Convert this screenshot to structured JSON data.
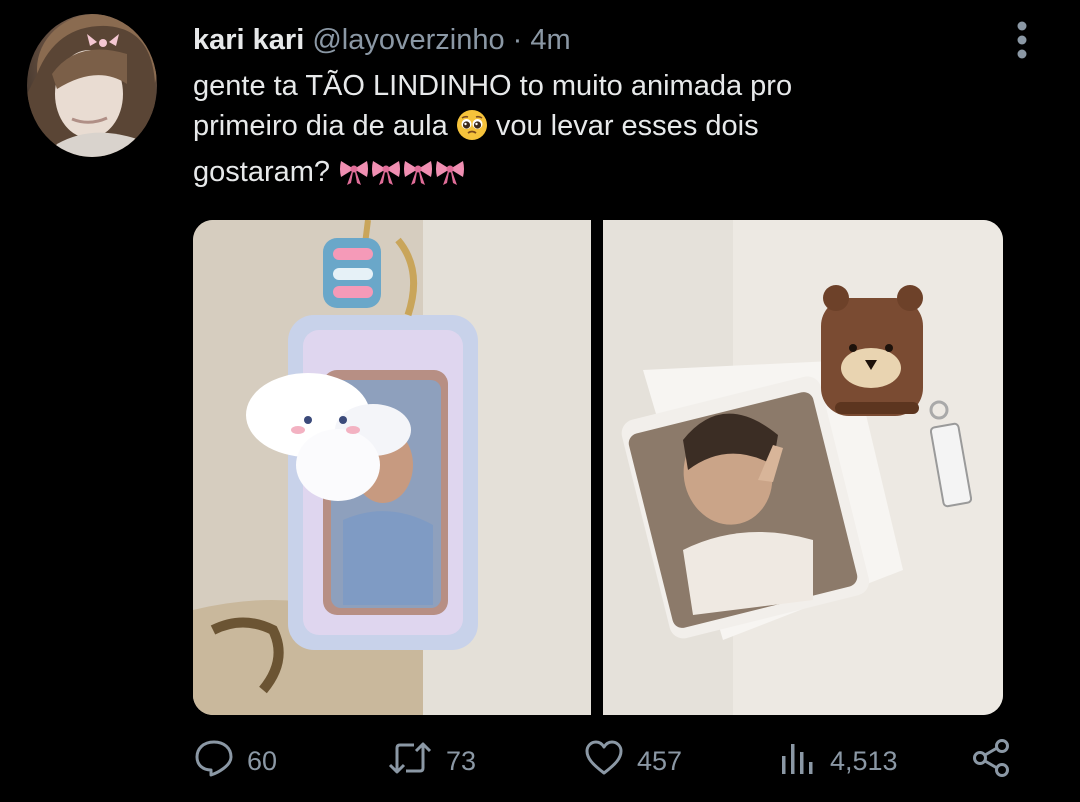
{
  "tweet": {
    "display_name": "kari kari",
    "handle": "@layoverzinho",
    "separator": "·",
    "time": "4m",
    "text_lines": [
      "gente ta TÃO LINDINHO to muito animada pro",
      "primeiro dia de aula",
      "vou levar esses dois",
      "gostaram?"
    ],
    "emojis": {
      "pleading": "pleading-face-emoji",
      "ribbon": "ribbon-emoji"
    },
    "media": [
      {
        "description_icon": "photo-image",
        "alt": ""
      },
      {
        "description_icon": "photo-image",
        "alt": ""
      }
    ],
    "actions": {
      "reply_count": "60",
      "retweet_count": "73",
      "like_count": "457",
      "views_count": "4,513"
    },
    "icons": {
      "reply": "reply-icon",
      "retweet": "retweet-icon",
      "like": "heart-icon",
      "views": "views-icon",
      "share": "share-icon",
      "more": "more-vertical-icon"
    }
  },
  "colors": {
    "background": "#000000",
    "primary_text": "#e7e9ea",
    "secondary_text": "#8b98a5",
    "ribbon_pink": "#f08fb2"
  }
}
